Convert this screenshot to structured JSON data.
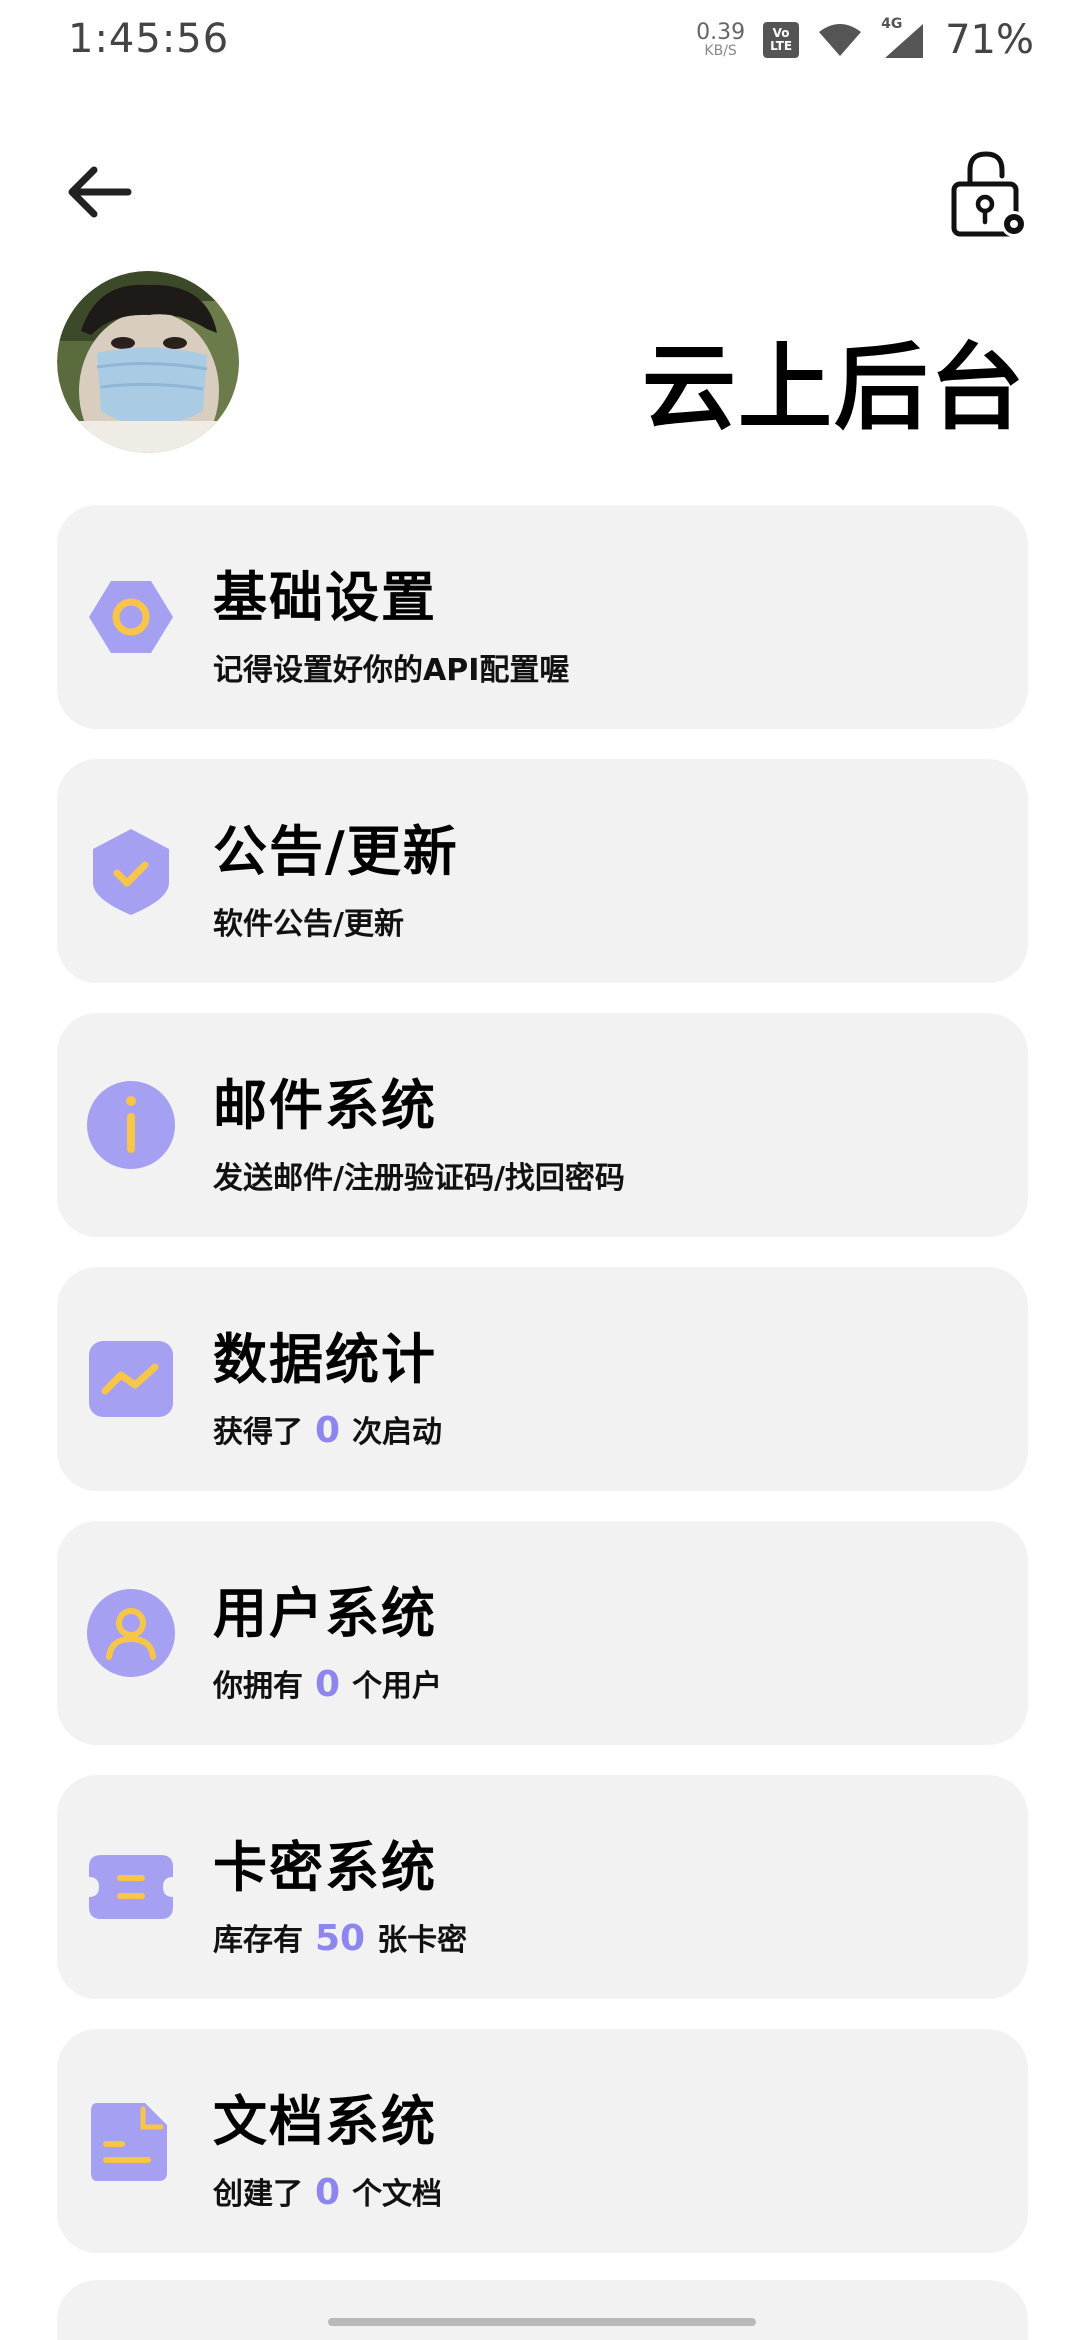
{
  "status_bar": {
    "time": "1:45:56",
    "net_speed": "0.39",
    "net_unit": "KB/S",
    "volte_top": "Vo",
    "volte_bottom": "LTE",
    "network": "4G",
    "battery": "71%"
  },
  "header": {
    "title": "云上后台"
  },
  "colors": {
    "accent": "#8c86ee",
    "icon_bg": "#a6a0f2",
    "icon_fg": "#f7c548",
    "card_bg": "#f2f2f2"
  },
  "cards": [
    {
      "title": "基础设置",
      "subtitle": "记得设置好你的API配置喔",
      "icon": "settings-hexagon-icon"
    },
    {
      "title": "公告/更新",
      "subtitle": "软件公告/更新",
      "icon": "shield-check-icon"
    },
    {
      "title": "邮件系统",
      "subtitle": "发送邮件/注册验证码/找回密码",
      "icon": "info-icon"
    },
    {
      "title": "数据统计",
      "subtitle_pre": "获得了",
      "count": "0",
      "subtitle_post": "次启动",
      "icon": "chart-line-icon"
    },
    {
      "title": "用户系统",
      "subtitle_pre": "你拥有",
      "count": "0",
      "subtitle_post": "个用户",
      "icon": "user-icon"
    },
    {
      "title": "卡密系统",
      "subtitle_pre": "库存有",
      "count": "50",
      "subtitle_post": "张卡密",
      "icon": "ticket-icon"
    },
    {
      "title": "文档系统",
      "subtitle_pre": "创建了",
      "count": "0",
      "subtitle_post": "个文档",
      "icon": "document-icon"
    }
  ]
}
